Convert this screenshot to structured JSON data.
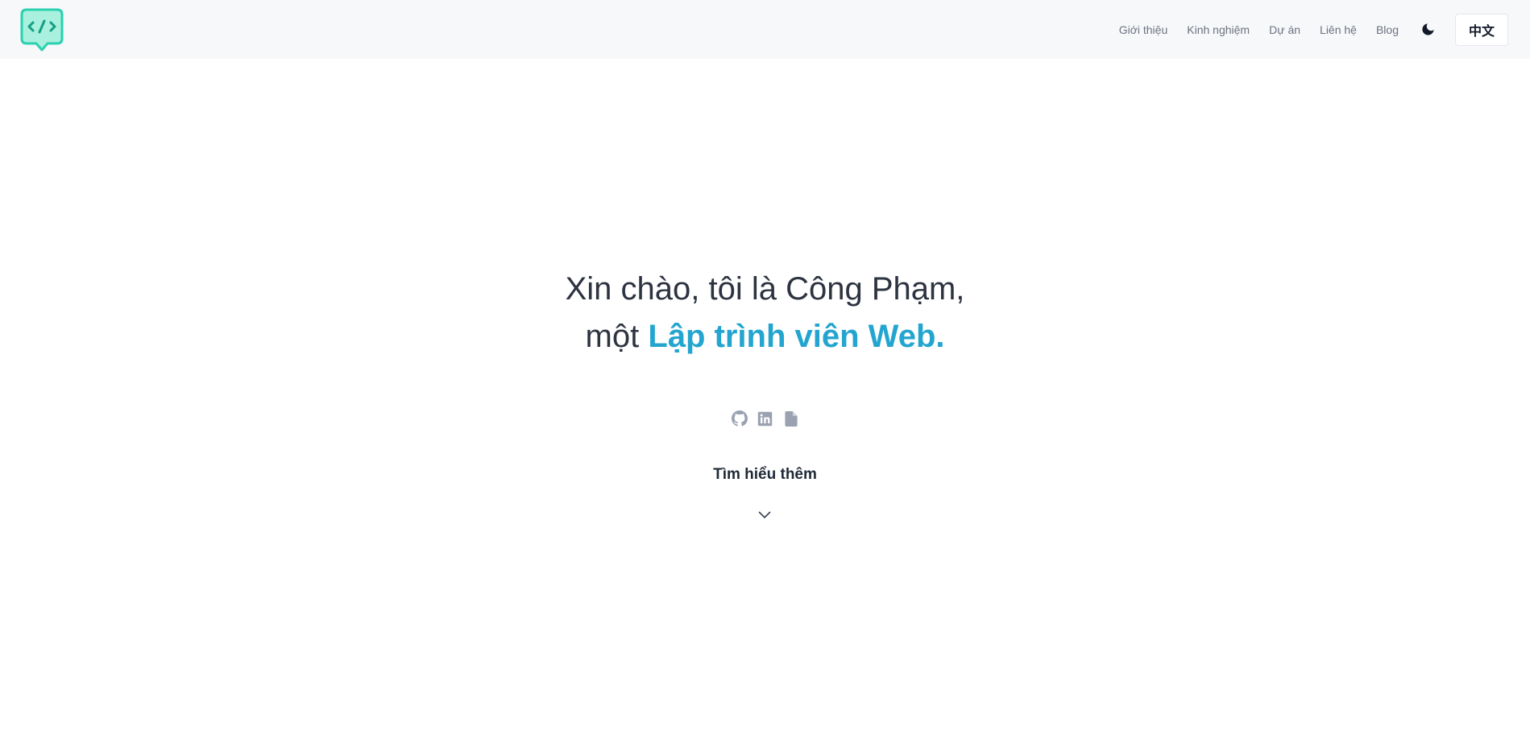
{
  "header": {
    "logo": {
      "icon": "code-bubble-icon",
      "color": "#2ad1b0"
    },
    "nav": [
      {
        "label": "Giới thiệu"
      },
      {
        "label": "Kinh nghiệm"
      },
      {
        "label": "Dự án"
      },
      {
        "label": "Liên hệ"
      },
      {
        "label": "Blog"
      }
    ],
    "theme_toggle": {
      "icon": "moon-icon"
    },
    "language_button": {
      "label": "中文"
    }
  },
  "hero": {
    "line1": "Xin chào, tôi là Công Phạm,",
    "line2_prefix": "một",
    "line2_highlight": "Lập trình viên Web.",
    "accent_color": "#23a5cf"
  },
  "socials": [
    {
      "icon": "github-icon"
    },
    {
      "icon": "linkedin-icon"
    },
    {
      "icon": "document-icon"
    }
  ],
  "learn_more": {
    "label": "Tìm hiểu thêm",
    "icon": "chevron-down-icon"
  }
}
